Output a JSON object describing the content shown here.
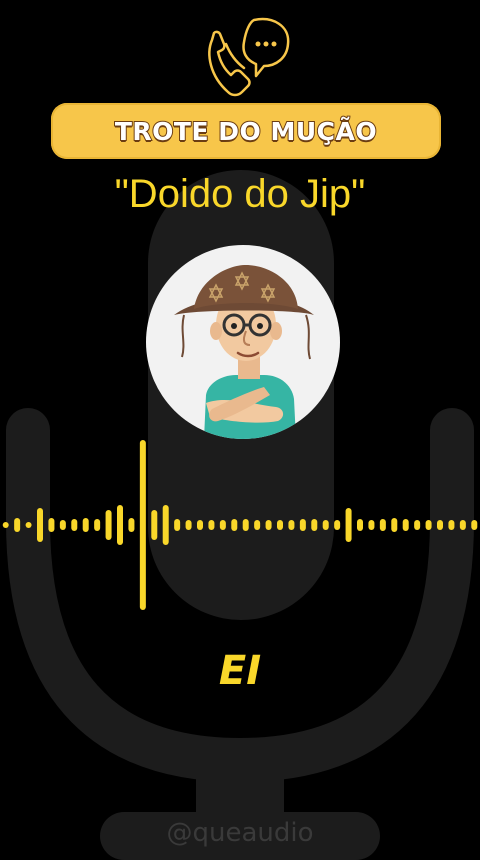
{
  "banner": {
    "title": "TROTE DO MUÇÃO"
  },
  "subtitle": "\"Doido do Jip\"",
  "avatar": {
    "icon": "cartoon-man-with-leather-hat"
  },
  "logo": {
    "icon": "phone-with-speech-bubble-icon"
  },
  "caption": "EI",
  "watermark": "@queaudio",
  "colors": {
    "background": "#000000",
    "accent": "#f9d72a",
    "banner": "#f7c64a",
    "banner_text_outline": "#6b3d12",
    "mic_silhouette": "#1c1c1c"
  }
}
